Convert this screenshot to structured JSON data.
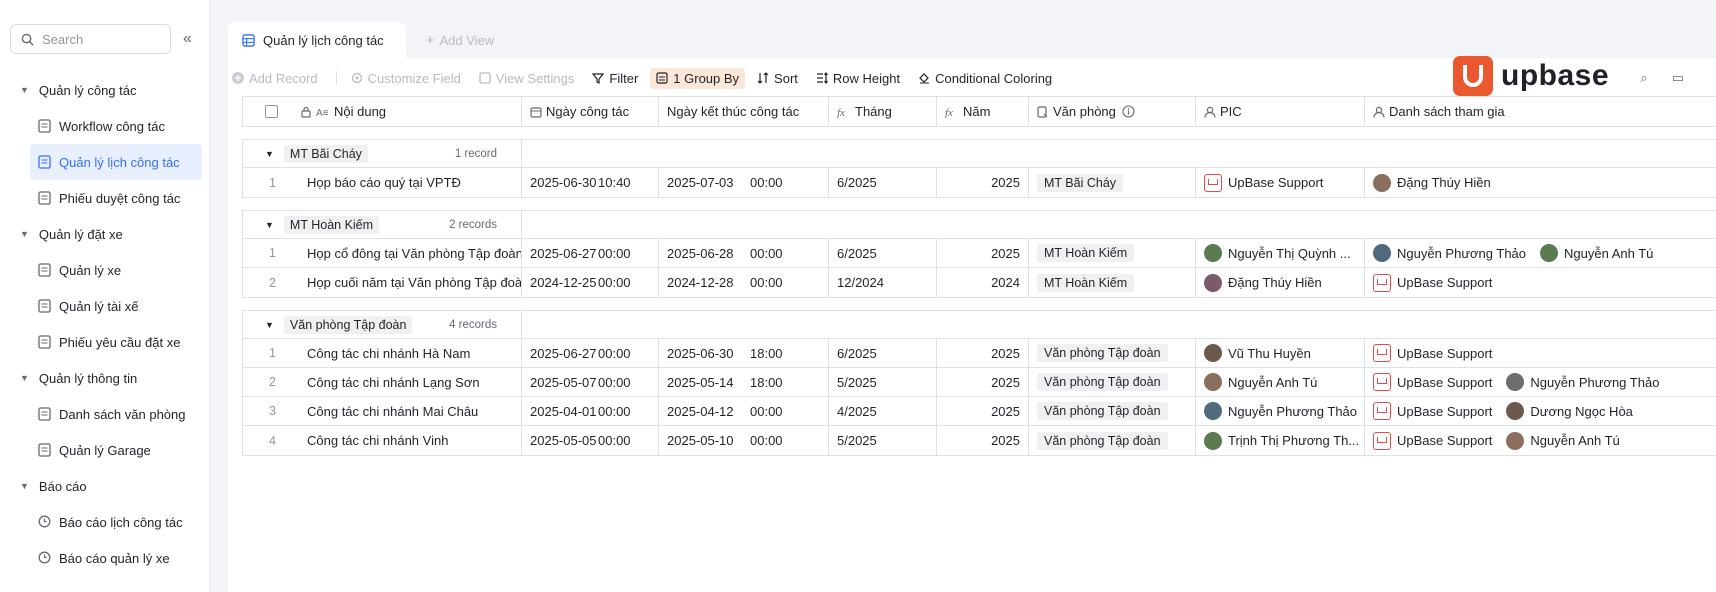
{
  "sidebar": {
    "search_placeholder": "Search",
    "groups": [
      {
        "label": "Quản lý công tác",
        "items": [
          "Workflow công tác",
          "Quản lý lịch công tác",
          "Phiếu duyệt công tác"
        ]
      },
      {
        "label": "Quản lý đặt xe",
        "items": [
          "Quản lý xe",
          "Quản lý tài xế",
          "Phiếu yêu cầu đặt xe"
        ]
      },
      {
        "label": "Quản lý thông tin",
        "items": [
          "Danh sách văn phòng",
          "Quản lý Garage"
        ]
      },
      {
        "label": "Báo cáo",
        "items": [
          "Báo cáo lịch công tác",
          "Báo cáo quản lý xe"
        ]
      }
    ]
  },
  "tabs": {
    "active": "Quản lý lịch công tác",
    "add_view": "Add View"
  },
  "toolbar": {
    "add_record": "Add Record",
    "customize_field": "Customize Field",
    "view_settings": "View Settings",
    "filter": "Filter",
    "group_by": "1 Group By",
    "sort": "Sort",
    "row_height": "Row Height",
    "conditional_coloring": "Conditional Coloring"
  },
  "logo": "upbase",
  "columns": [
    "Nội dung",
    "Ngày công tác",
    "Ngày kết thúc công tác",
    "Tháng",
    "Năm",
    "Văn phòng",
    "PIC",
    "Danh sách tham gia"
  ],
  "groups": [
    {
      "name": "MT Bãi Cháy",
      "count": "1 record",
      "rows": [
        {
          "n": "1",
          "title": "Họp báo cáo quý tại VPTĐ",
          "start_d": "2025-06-30",
          "start_t": "10:40",
          "end_d": "2025-07-03",
          "end_t": "00:00",
          "month": "6/2025",
          "year": "2025",
          "office": "MT Bãi Cháy",
          "pic": "UpBase Support",
          "members": [
            "Đặng Thúy Hiền"
          ]
        }
      ]
    },
    {
      "name": "MT Hoàn Kiếm",
      "count": "2 records",
      "rows": [
        {
          "n": "1",
          "title": "Họp cổ đông tại Văn phòng Tập đoàn",
          "start_d": "2025-06-27",
          "start_t": "00:00",
          "end_d": "2025-06-28",
          "end_t": "00:00",
          "month": "6/2025",
          "year": "2025",
          "office": "MT Hoàn Kiếm",
          "pic": "Nguyễn Thị Quỳnh ...",
          "members": [
            "Nguyễn Phương Thảo",
            "Nguyễn Anh Tú"
          ]
        },
        {
          "n": "2",
          "title": "Họp cuối năm tại Văn phòng Tập đoàn",
          "start_d": "2024-12-25",
          "start_t": "00:00",
          "end_d": "2024-12-28",
          "end_t": "00:00",
          "month": "12/2024",
          "year": "2024",
          "office": "MT Hoàn Kiếm",
          "pic": "Đặng Thúy Hiền",
          "members": [
            "UpBase Support"
          ]
        }
      ]
    },
    {
      "name": "Văn phòng Tập đoàn",
      "count": "4 records",
      "rows": [
        {
          "n": "1",
          "title": "Công tác chi nhánh Hà Nam",
          "start_d": "2025-06-27",
          "start_t": "00:00",
          "end_d": "2025-06-30",
          "end_t": "18:00",
          "month": "6/2025",
          "year": "2025",
          "office": "Văn phòng Tập đoàn",
          "pic": "Vũ Thu Huyền",
          "members": [
            "UpBase Support"
          ]
        },
        {
          "n": "2",
          "title": "Công tác chi nhánh Lạng Sơn",
          "start_d": "2025-05-07",
          "start_t": "00:00",
          "end_d": "2025-05-14",
          "end_t": "18:00",
          "month": "5/2025",
          "year": "2025",
          "office": "Văn phòng Tập đoàn",
          "pic": "Nguyễn Anh Tú",
          "members": [
            "UpBase Support",
            "Nguyễn Phương Thảo"
          ]
        },
        {
          "n": "3",
          "title": "Công tác chi nhánh Mai Châu",
          "start_d": "2025-04-01",
          "start_t": "00:00",
          "end_d": "2025-04-12",
          "end_t": "00:00",
          "month": "4/2025",
          "year": "2025",
          "office": "Văn phòng Tập đoàn",
          "pic": "Nguyễn Phương Thảo",
          "members": [
            "UpBase Support",
            "Dương Ngọc Hòa"
          ]
        },
        {
          "n": "4",
          "title": "Công tác chi nhánh Vinh",
          "start_d": "2025-05-05",
          "start_t": "00:00",
          "end_d": "2025-05-10",
          "end_t": "00:00",
          "month": "5/2025",
          "year": "2025",
          "office": "Văn phòng Tập đoàn",
          "pic": "Trịnh Thị Phương Th...",
          "members": [
            "UpBase Support",
            "Nguyễn Anh Tú"
          ]
        }
      ]
    }
  ],
  "colors": {
    "accent": "#3370ff",
    "logo": "#e9582f",
    "highlight": "#fbe7d8"
  }
}
